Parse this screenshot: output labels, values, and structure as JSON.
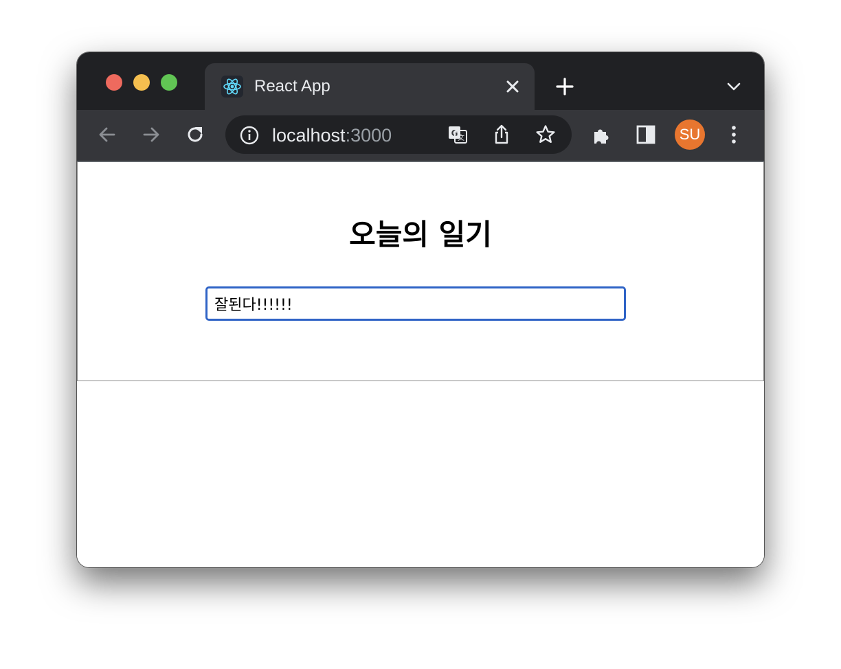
{
  "browser": {
    "tab": {
      "title": "React App",
      "favicon": "react-logo-icon"
    },
    "address_bar": {
      "host": "localhost",
      "port": ":3000"
    },
    "profile": {
      "initials": "SU",
      "color": "#e8762f"
    },
    "icons": {
      "back": "arrow-left-icon",
      "forward": "arrow-right-icon",
      "reload": "reload-icon",
      "site_info": "info-icon",
      "translate": "translate-icon",
      "share": "share-icon",
      "bookmark": "star-icon",
      "extensions": "puzzle-icon",
      "side_panel": "side-panel-icon",
      "menu": "kebab-menu-icon",
      "new_tab": "plus-icon",
      "tab_search": "chevron-down-icon",
      "close_tab": "close-icon"
    }
  },
  "page": {
    "title": "오늘의 일기",
    "input_value": "잘된다!!!!!!",
    "accent_color": "#2f63c6"
  }
}
